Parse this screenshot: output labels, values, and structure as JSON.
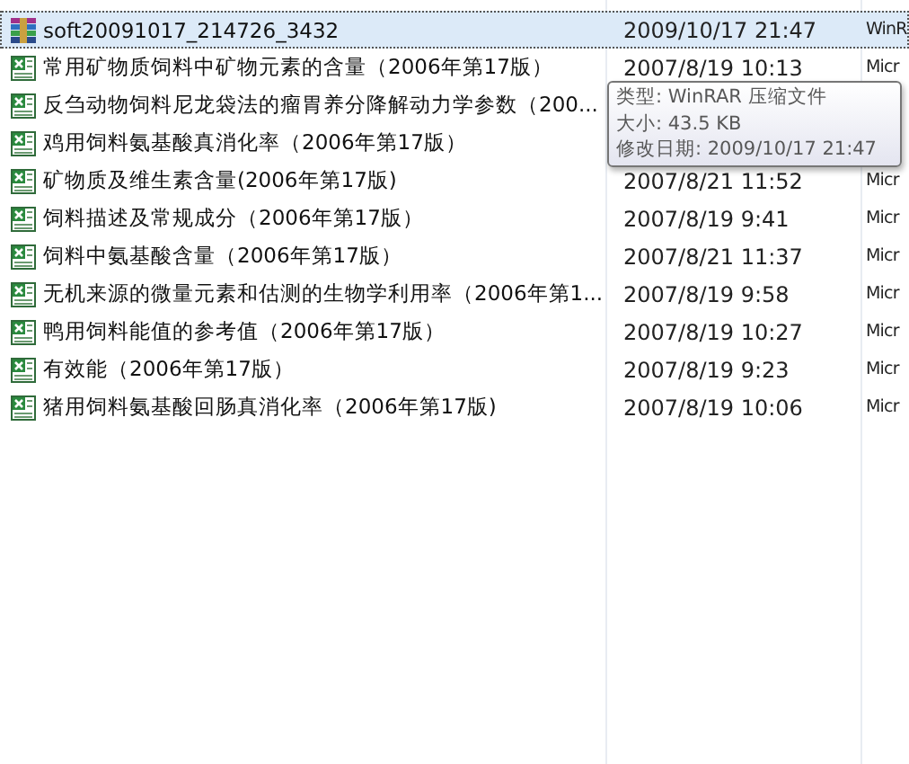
{
  "files": [
    {
      "kind": "archive",
      "name": "soft20091017_214726_3432",
      "date": "2009/10/17 21:47",
      "type": "WinR",
      "selected": true
    },
    {
      "kind": "excel",
      "name": "常用矿物质饲料中矿物元素的含量（2006年第17版）",
      "date": "2007/8/19 10:13",
      "type": "Micr",
      "selected": false
    },
    {
      "kind": "excel",
      "name": "反刍动物饲料尼龙袋法的瘤胃养分降解动力学参数（200...",
      "selected": false
    },
    {
      "kind": "excel",
      "name": "鸡用饲料氨基酸真消化率（2006年第17版）",
      "selected": false
    },
    {
      "kind": "excel",
      "name": "矿物质及维生素含量(2006年第17版)",
      "date": "2007/8/21 11:52",
      "type": "Micr",
      "selected": false
    },
    {
      "kind": "excel",
      "name": "饲料描述及常规成分（2006年第17版）",
      "date": "2007/8/19 9:41",
      "type": "Micr",
      "selected": false
    },
    {
      "kind": "excel",
      "name": "饲料中氨基酸含量（2006年第17版）",
      "date": "2007/8/21 11:37",
      "type": "Micr",
      "selected": false
    },
    {
      "kind": "excel",
      "name": "无机来源的微量元素和估测的生物学利用率（2006年第1...",
      "date": "2007/8/19 9:58",
      "type": "Micr",
      "selected": false
    },
    {
      "kind": "excel",
      "name": "鸭用饲料能值的参考值（2006年第17版）",
      "date": "2007/8/19 10:27",
      "type": "Micr",
      "selected": false
    },
    {
      "kind": "excel",
      "name": "有效能（2006年第17版）",
      "date": "2007/8/19 9:23",
      "type": "Micr",
      "selected": false
    },
    {
      "kind": "excel",
      "name": "猪用饲料氨基酸回肠真消化率（2006年第17版)",
      "date": "2007/8/19 10:06",
      "type": "Micr",
      "selected": false
    }
  ],
  "tooltip": [
    "类型: WinRAR 压缩文件",
    "大小: 43.5 KB",
    "修改日期: 2009/10/17 21:47"
  ]
}
